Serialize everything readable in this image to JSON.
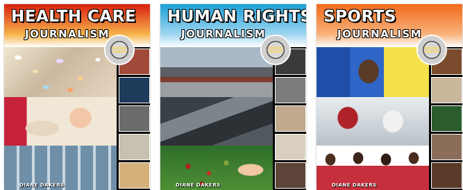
{
  "covers": [
    {
      "title": "HEALTH CARE",
      "subtitle": "JOURNALISM",
      "author": "DIANE DAKERS",
      "banner_colors": [
        "#d9200f",
        "#f6b34a",
        "#ffffff"
      ],
      "side_color": "#000000",
      "photos": [
        "pills",
        "patient",
        "hallway"
      ],
      "thumbs": [
        "#a14a3a",
        "#1f3b5c",
        "#2a2a2a",
        "#c8c0b0",
        "#d6b07a"
      ]
    },
    {
      "title": "HUMAN RIGHTS",
      "subtitle": "JOURNALISM",
      "author": "DIANE DAKERS",
      "banner_colors": [
        "#1ca0d8",
        "#9fd6f0",
        "#ffffff"
      ],
      "side_color": "#000000",
      "photos": [
        "ships",
        "road",
        "coffee"
      ],
      "thumbs": [
        "#3a3a3a",
        "#7c7c7c",
        "#c0a98c",
        "#d8cfbf",
        "#5c4438"
      ]
    },
    {
      "title": "SPORTS",
      "subtitle": "JOURNALISM",
      "author": "DIANE DAKERS",
      "banner_colors": [
        "#f26a1b",
        "#f8b27c",
        "#ffffff"
      ],
      "side_color": "#000000",
      "photos": [
        "fifa",
        "hockey",
        "team"
      ],
      "thumbs": [
        "#7a4b2c",
        "#c9b79c",
        "#2b5c2e",
        "#8a6e5a",
        "#5a3b2a"
      ]
    }
  ],
  "badge_text": "INSPIRED CAREERS"
}
